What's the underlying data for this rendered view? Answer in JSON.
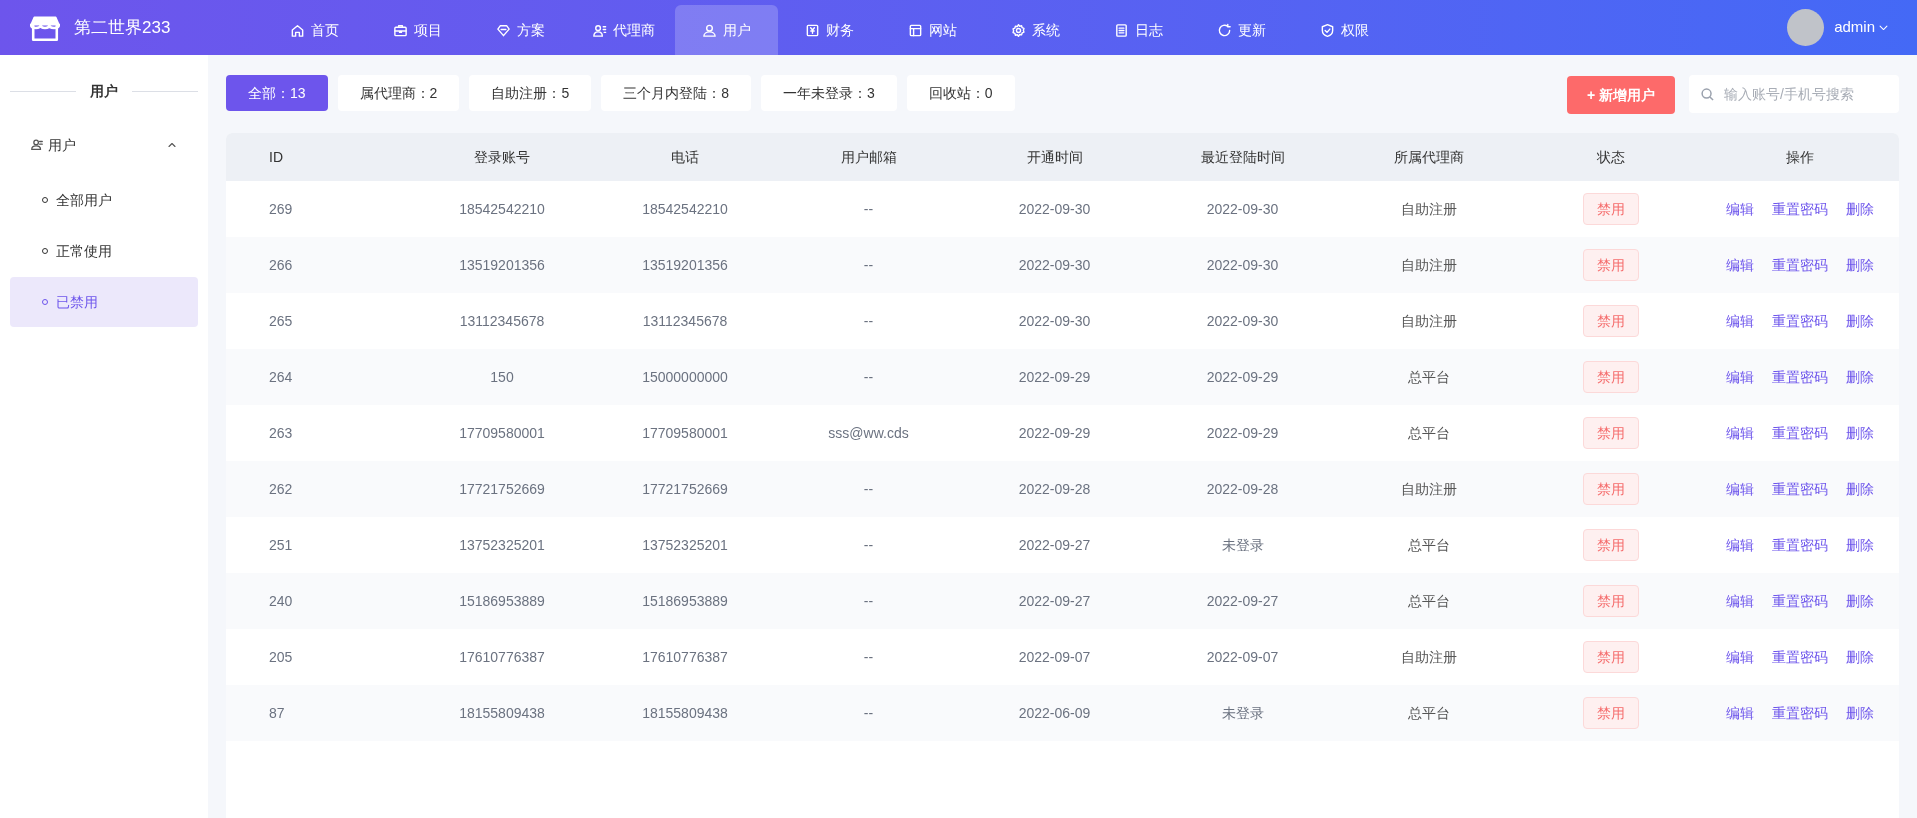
{
  "header": {
    "logo_text": "第二世界233",
    "nav": [
      {
        "label": "首页",
        "selected": false
      },
      {
        "label": "项目",
        "selected": false
      },
      {
        "label": "方案",
        "selected": false
      },
      {
        "label": "代理商",
        "selected": false
      },
      {
        "label": "用户",
        "selected": true
      },
      {
        "label": "财务",
        "selected": false
      },
      {
        "label": "网站",
        "selected": false
      },
      {
        "label": "系统",
        "selected": false
      },
      {
        "label": "日志",
        "selected": false
      },
      {
        "label": "更新",
        "selected": false
      },
      {
        "label": "权限",
        "selected": false
      }
    ],
    "user": {
      "name": "admin"
    }
  },
  "sidebar": {
    "title": "用户",
    "groups": [
      {
        "label": "用户",
        "expanded": true,
        "children": [
          {
            "label": "全部用户",
            "selected": false
          },
          {
            "label": "正常使用",
            "selected": false
          },
          {
            "label": "已禁用",
            "selected": true
          }
        ]
      }
    ]
  },
  "filters": [
    {
      "label": "全部：13",
      "selected": true
    },
    {
      "label": "属代理商：2",
      "selected": false
    },
    {
      "label": "自助注册：5",
      "selected": false
    },
    {
      "label": "三个月内登陆：8",
      "selected": false
    },
    {
      "label": "一年未登录：3",
      "selected": false
    },
    {
      "label": "回收站：0",
      "selected": false
    }
  ],
  "add_button": "+ 新增用户",
  "search": {
    "placeholder": "输入账号/手机号搜索"
  },
  "table": {
    "columns": [
      "ID",
      "登录账号",
      "电话",
      "用户邮箱",
      "开通时间",
      "最近登陆时间",
      "所属代理商",
      "状态",
      "操作"
    ],
    "rows": [
      {
        "id": "269",
        "account": "18542542210",
        "phone": "18542542210",
        "email": "--",
        "created": "2022-09-30",
        "last_login": "2022-09-30",
        "agent": "自助注册",
        "status": "禁用",
        "actions": [
          "编辑",
          "重置密码",
          "删除"
        ]
      },
      {
        "id": "266",
        "account": "13519201356",
        "phone": "13519201356",
        "email": "--",
        "created": "2022-09-30",
        "last_login": "2022-09-30",
        "agent": "自助注册",
        "status": "禁用",
        "actions": [
          "编辑",
          "重置密码",
          "删除"
        ]
      },
      {
        "id": "265",
        "account": "13112345678",
        "phone": "13112345678",
        "email": "--",
        "created": "2022-09-30",
        "last_login": "2022-09-30",
        "agent": "自助注册",
        "status": "禁用",
        "actions": [
          "编辑",
          "重置密码",
          "删除"
        ]
      },
      {
        "id": "264",
        "account": "150",
        "phone": "15000000000",
        "email": "--",
        "created": "2022-09-29",
        "last_login": "2022-09-29",
        "agent": "总平台",
        "status": "禁用",
        "actions": [
          "编辑",
          "重置密码",
          "删除"
        ]
      },
      {
        "id": "263",
        "account": "17709580001",
        "phone": "17709580001",
        "email": "sss@ww.cds",
        "created": "2022-09-29",
        "last_login": "2022-09-29",
        "agent": "总平台",
        "status": "禁用",
        "actions": [
          "编辑",
          "重置密码",
          "删除"
        ]
      },
      {
        "id": "262",
        "account": "17721752669",
        "phone": "17721752669",
        "email": "--",
        "created": "2022-09-28",
        "last_login": "2022-09-28",
        "agent": "自助注册",
        "status": "禁用",
        "actions": [
          "编辑",
          "重置密码",
          "删除"
        ]
      },
      {
        "id": "251",
        "account": "13752325201",
        "phone": "13752325201",
        "email": "--",
        "created": "2022-09-27",
        "last_login": "未登录",
        "agent": "总平台",
        "status": "禁用",
        "actions": [
          "编辑",
          "重置密码",
          "删除"
        ]
      },
      {
        "id": "240",
        "account": "15186953889",
        "phone": "15186953889",
        "email": "--",
        "created": "2022-09-27",
        "last_login": "2022-09-27",
        "agent": "总平台",
        "status": "禁用",
        "actions": [
          "编辑",
          "重置密码",
          "删除"
        ]
      },
      {
        "id": "205",
        "account": "17610776387",
        "phone": "17610776387",
        "email": "--",
        "created": "2022-09-07",
        "last_login": "2022-09-07",
        "agent": "自助注册",
        "status": "禁用",
        "actions": [
          "编辑",
          "重置密码",
          "删除"
        ]
      },
      {
        "id": "87",
        "account": "18155809438",
        "phone": "18155809438",
        "email": "--",
        "created": "2022-06-09",
        "last_login": "未登录",
        "agent": "总平台",
        "status": "禁用",
        "actions": [
          "编辑",
          "重置密码",
          "删除"
        ]
      }
    ]
  }
}
